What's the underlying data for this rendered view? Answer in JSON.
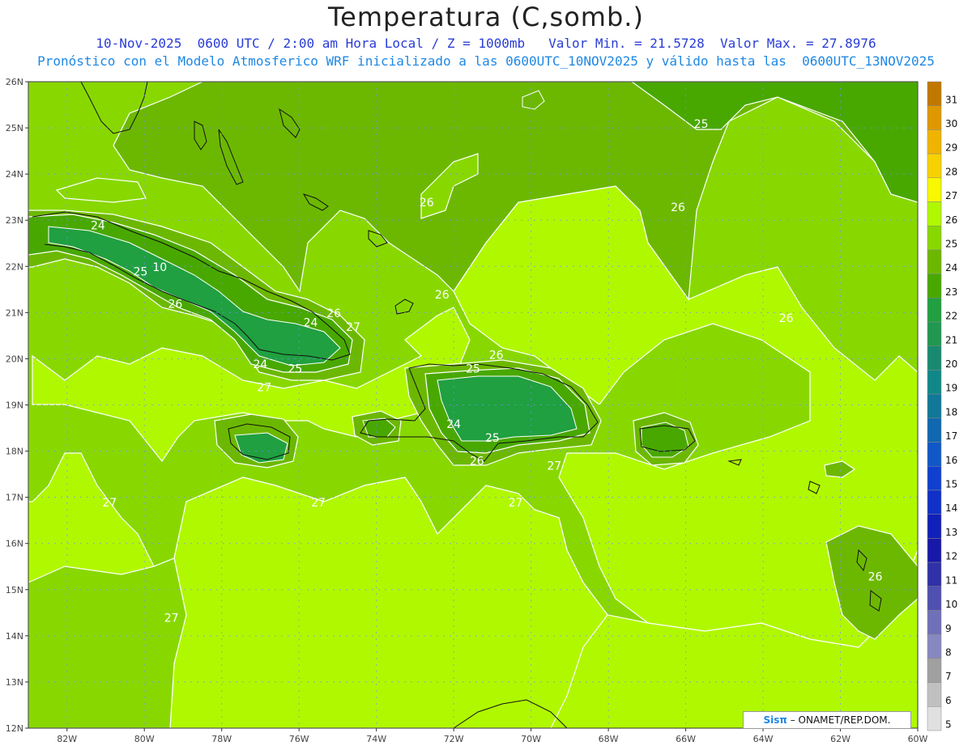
{
  "title": "Temperatura (C,somb.)",
  "subtitle1": "10-Nov-2025  0600 UTC / 2:00 am Hora Local / Z = 1000mb   Valor Min. = 21.5728  Valor Max. = 27.8976",
  "subtitle2": "Pronóstico con el Modelo Atmosferico WRF inicializado a las 0600UTC_10NOV2025 y válido hasta las  0600UTC_13NOV2025",
  "credit": {
    "brand": "Sisπ",
    "org": " – ONAMET/REP.DOM."
  },
  "lat_labels": [
    "26N",
    "25N",
    "24N",
    "23N",
    "22N",
    "21N",
    "20N",
    "19N",
    "18N",
    "17N",
    "16N",
    "15N",
    "14N",
    "13N",
    "12N"
  ],
  "lon_labels": [
    "82W",
    "80W",
    "78W",
    "76W",
    "74W",
    "72W",
    "70W",
    "68W",
    "66W",
    "64W",
    "62W",
    "60W"
  ],
  "colorbar": {
    "labels": [
      "31",
      "30",
      "29",
      "28",
      "27",
      "26",
      "25",
      "24",
      "23",
      "22",
      "21",
      "20",
      "19",
      "18",
      "17",
      "16",
      "15",
      "14",
      "13",
      "12",
      "11",
      "10",
      "9",
      "8",
      "7",
      "6",
      "5"
    ],
    "colors": [
      "#c07800",
      "#e09800",
      "#f0b400",
      "#f8d200",
      "#f8f800",
      "#b0f800",
      "#88d800",
      "#6cb800",
      "#48a800",
      "#20a040",
      "#209850",
      "#188a70",
      "#108888",
      "#107898",
      "#1068b0",
      "#1058c8",
      "#1040d0",
      "#1030c8",
      "#1020b8",
      "#1818a8",
      "#3030a8",
      "#5050b0",
      "#7070b8",
      "#8888c0",
      "#a0a0a0",
      "#c0c0c0",
      "#e0e0e0"
    ]
  },
  "contour_labels": [
    {
      "text": "24",
      "lon": -81.2,
      "lat": 22.8
    },
    {
      "text": "25",
      "lon": -80.1,
      "lat": 21.8
    },
    {
      "text": "10",
      "lon": -79.6,
      "lat": 21.9
    },
    {
      "text": "26",
      "lon": -79.2,
      "lat": 21.1
    },
    {
      "text": "24",
      "lon": -75.7,
      "lat": 20.7
    },
    {
      "text": "26",
      "lon": -75.1,
      "lat": 20.9
    },
    {
      "text": "27",
      "lon": -74.6,
      "lat": 20.6
    },
    {
      "text": "24",
      "lon": -77.0,
      "lat": 19.8
    },
    {
      "text": "25",
      "lon": -76.1,
      "lat": 19.7
    },
    {
      "text": "27",
      "lon": -76.9,
      "lat": 19.3
    },
    {
      "text": "26",
      "lon": -72.7,
      "lat": 23.3
    },
    {
      "text": "26",
      "lon": -72.3,
      "lat": 21.3
    },
    {
      "text": "26",
      "lon": -66.2,
      "lat": 23.2
    },
    {
      "text": "25",
      "lon": -65.6,
      "lat": 25.0
    },
    {
      "text": "26",
      "lon": -70.9,
      "lat": 20.0
    },
    {
      "text": "25",
      "lon": -71.5,
      "lat": 19.7
    },
    {
      "text": "24",
      "lon": -72.0,
      "lat": 18.5
    },
    {
      "text": "25",
      "lon": -71.0,
      "lat": 18.2
    },
    {
      "text": "26",
      "lon": -71.4,
      "lat": 17.7
    },
    {
      "text": "27",
      "lon": -69.4,
      "lat": 17.6
    },
    {
      "text": "27",
      "lon": -80.9,
      "lat": 16.8
    },
    {
      "text": "27",
      "lon": -75.5,
      "lat": 16.8
    },
    {
      "text": "27",
      "lon": -70.4,
      "lat": 16.8
    },
    {
      "text": "26",
      "lon": -63.4,
      "lat": 20.8
    },
    {
      "text": "26",
      "lon": -61.1,
      "lat": 15.2
    },
    {
      "text": "27",
      "lon": -79.3,
      "lat": 14.3
    }
  ]
}
